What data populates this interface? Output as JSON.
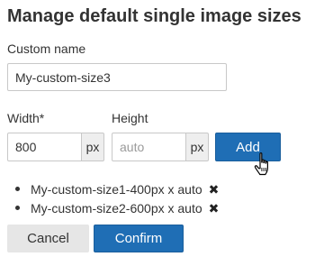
{
  "dialog": {
    "title": "Manage default single image sizes"
  },
  "custom_name": {
    "label": "Custom name",
    "value": "My-custom-size3"
  },
  "width": {
    "label": "Width*",
    "value": "800",
    "unit": "px"
  },
  "height": {
    "label": "Height",
    "placeholder": "auto",
    "unit": "px"
  },
  "buttons": {
    "add": "Add",
    "cancel": "Cancel",
    "confirm": "Confirm"
  },
  "sizes": [
    {
      "text": "My-custom-size1-400px x auto",
      "remove_icon": "✖"
    },
    {
      "text": "My-custom-size2-600px x auto",
      "remove_icon": "✖"
    }
  ],
  "icons": {
    "remove": "close-x-icon",
    "cursor": "hand-pointer-icon"
  },
  "colors": {
    "primary": "#1f6eb5",
    "default_button": "#e6e6e6",
    "addon_bg": "#eeeeee",
    "border": "#c8c8c8",
    "text": "#333333"
  }
}
